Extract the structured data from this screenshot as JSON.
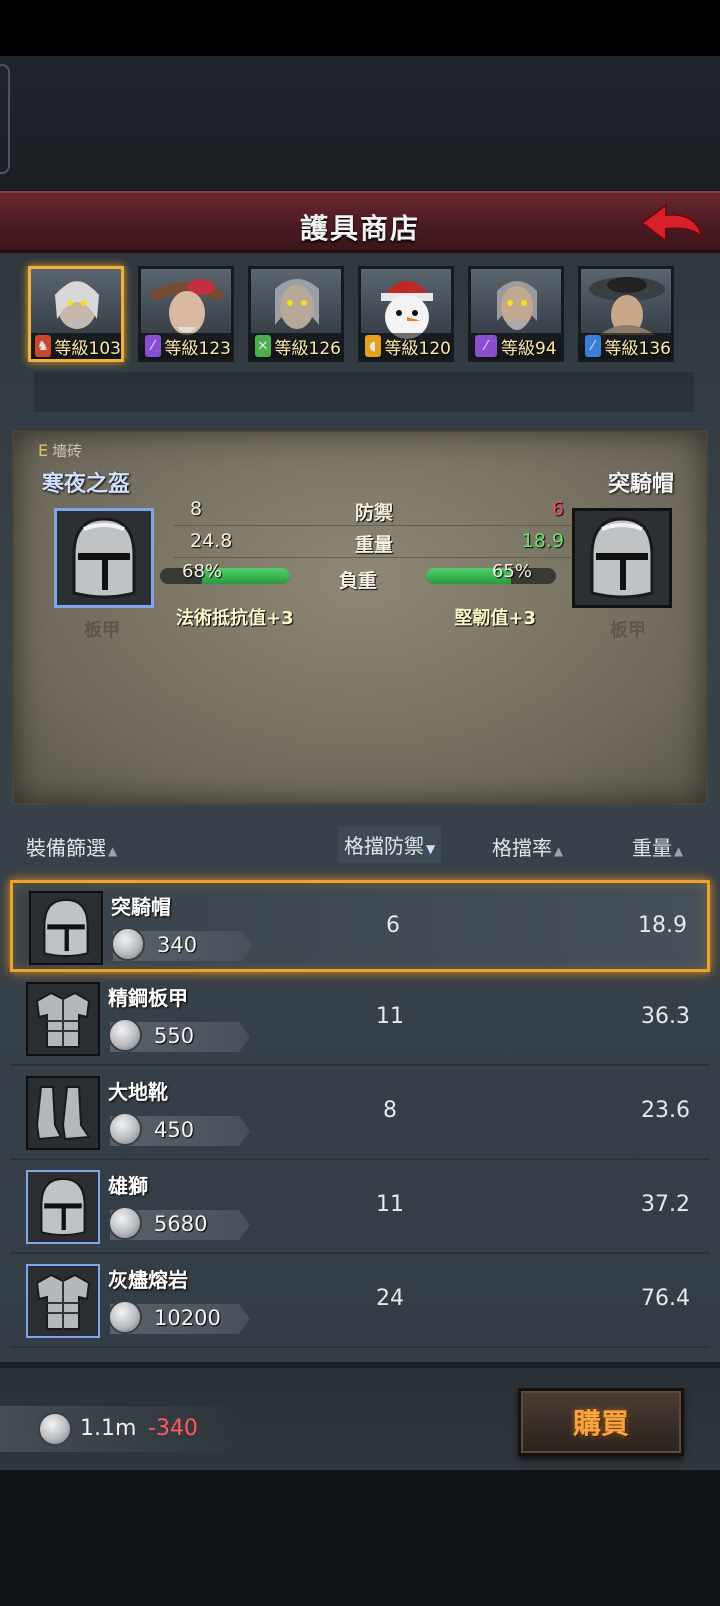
{
  "header": {
    "title": "護具商店",
    "back_icon": "red-back-arrow-icon"
  },
  "heroes": [
    {
      "level_text": "等級103",
      "class_icon": "horse-icon",
      "class_color": "#c9482f",
      "selected": true
    },
    {
      "level_text": "等級123",
      "class_icon": "staff-icon",
      "class_color": "#8a4fd0",
      "selected": false
    },
    {
      "level_text": "等級126",
      "class_icon": "bow-icon",
      "class_color": "#4cae4c",
      "selected": false
    },
    {
      "level_text": "等級120",
      "class_icon": "shield-icon",
      "class_color": "#e2a21e",
      "selected": false
    },
    {
      "level_text": "等級94",
      "class_icon": "staff-icon",
      "class_color": "#8a4fd0",
      "selected": false
    },
    {
      "level_text": "等級136",
      "class_icon": "wand-icon",
      "class_color": "#3c7fd8",
      "selected": false
    }
  ],
  "compare": {
    "rank": "E",
    "rank_tag": "墻砖",
    "left_name": "寒夜之盔",
    "right_name": "突騎帽",
    "left_type": "板甲",
    "right_type": "板甲",
    "rows": [
      {
        "left": "8",
        "label": "防禦",
        "right": "6",
        "right_color": "#e25060"
      },
      {
        "left": "24.8",
        "label": "重量",
        "right": "18.9",
        "right_color": "#6ee06e"
      }
    ],
    "load": {
      "label": "負重",
      "left_text": "68%",
      "left_value": 68,
      "right_text": "65%",
      "right_value": 65
    },
    "left_bonus": "法術抵抗值+3",
    "right_bonus": "堅韌值+3"
  },
  "columns": {
    "filter": "裝備篩選",
    "block_def": "格擋防禦",
    "block_rate": "格擋率",
    "weight": "重量"
  },
  "items": [
    {
      "name": "突騎帽",
      "price": "340",
      "block": "6",
      "weight": "18.9",
      "icon": "helmet-icon",
      "selected": true,
      "blue": false
    },
    {
      "name": "精鋼板甲",
      "price": "550",
      "block": "11",
      "weight": "36.3",
      "icon": "plate-armor-icon",
      "selected": false,
      "blue": false
    },
    {
      "name": "大地靴",
      "price": "450",
      "block": "8",
      "weight": "23.6",
      "icon": "boots-icon",
      "selected": false,
      "blue": false
    },
    {
      "name": "雄獅",
      "price": "5680",
      "block": "11",
      "weight": "37.2",
      "icon": "helmet-icon",
      "selected": false,
      "blue": true
    },
    {
      "name": "灰燼熔岩",
      "price": "10200",
      "block": "24",
      "weight": "76.4",
      "icon": "plate-armor-icon",
      "selected": false,
      "blue": true
    }
  ],
  "footer": {
    "balance": "1.1m",
    "delta": "-340",
    "buy_label": "購買"
  }
}
